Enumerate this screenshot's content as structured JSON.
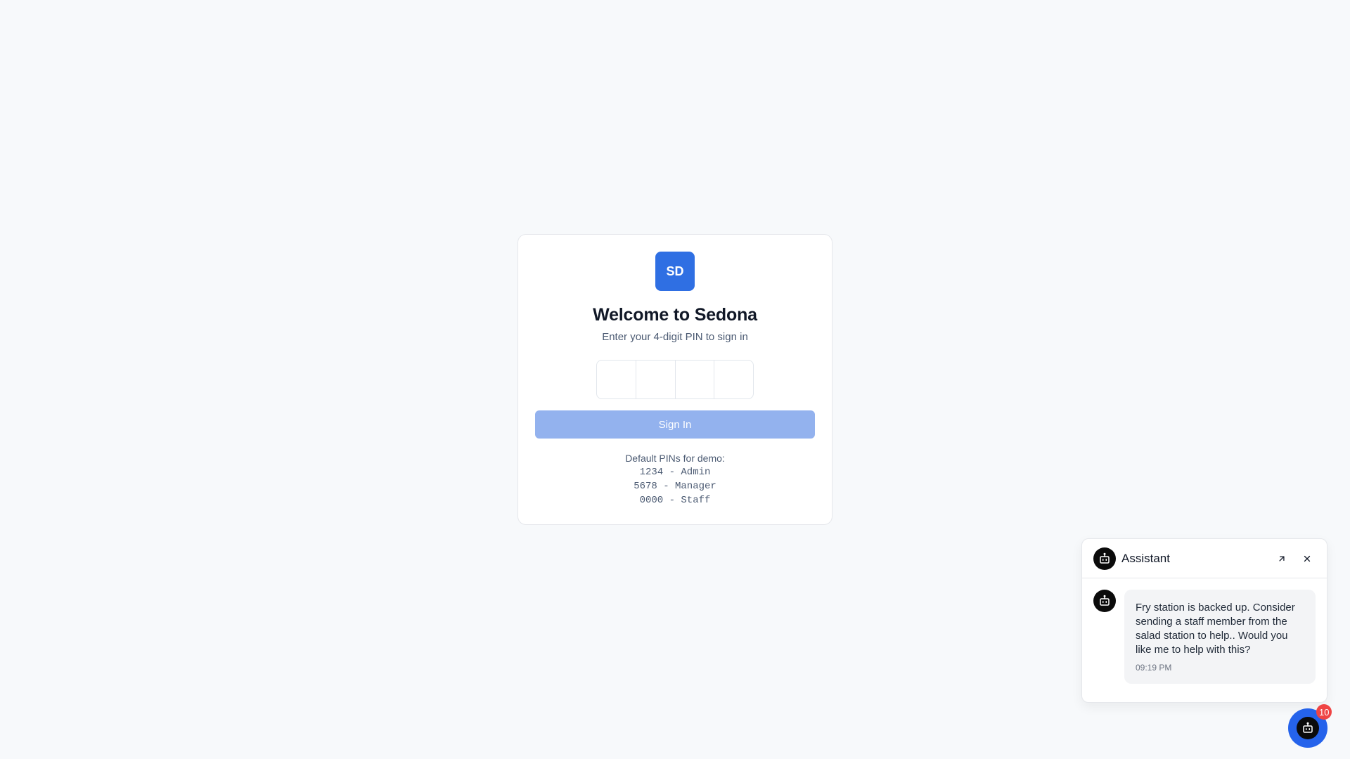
{
  "login": {
    "logo_text": "SD",
    "title": "Welcome to Sedona",
    "subtitle": "Enter your 4-digit PIN to sign in",
    "pin_values": [
      "",
      "",
      "",
      ""
    ],
    "signin_label": "Sign In",
    "demo_heading": "Default PINs for demo:",
    "demo_pins": [
      "1234 - Admin",
      "5678 - Manager",
      "0000 - Staff"
    ]
  },
  "assistant": {
    "title": "Assistant",
    "avatar_icon": "robot-icon",
    "expand_icon": "arrow-up-right-icon",
    "close_icon": "close-icon",
    "messages": [
      {
        "text": "Fry station is backed up. Consider sending a staff member from the salad station to help.. Would you like me to help with this?",
        "time": "09:19 PM"
      }
    ]
  },
  "fab": {
    "icon": "robot-icon",
    "badge_count": "10"
  },
  "colors": {
    "accent": "#2f6fe3",
    "button_disabled": "#93b2ee",
    "badge": "#ef4444",
    "background": "#f7f9fb"
  }
}
